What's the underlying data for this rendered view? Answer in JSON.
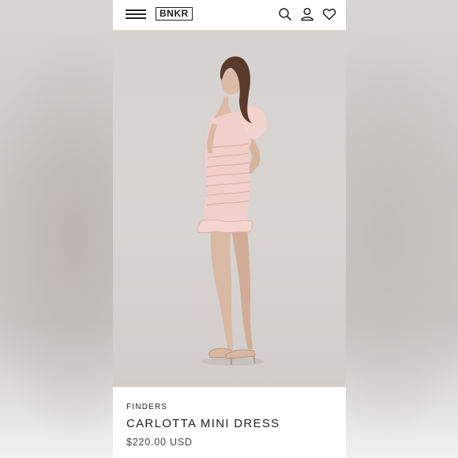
{
  "header": {
    "logo_text": "BNKR",
    "icons": [
      "menu-icon",
      "search-icon",
      "account-icon",
      "wishlist-icon"
    ]
  },
  "product": {
    "brand": "FINDERS",
    "name": "CARLOTTA MINI DRESS",
    "price": "$220.00 USD",
    "image_alt": "Model wearing a light pink ruched mini dress with puff sleeves"
  },
  "colors": {
    "dress": "#f1cfca",
    "photo_background": "#d6d2cf",
    "text": "#222222"
  }
}
